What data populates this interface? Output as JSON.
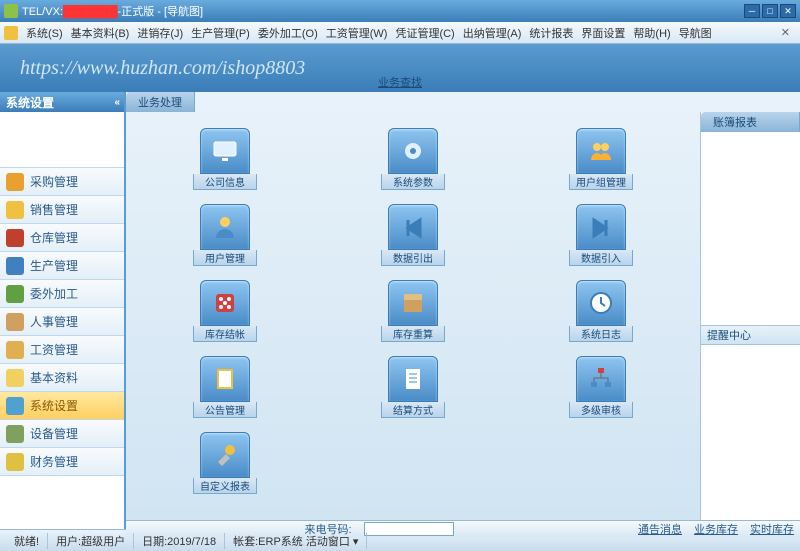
{
  "title": {
    "prefix": "TEL/VX:",
    "redacted": "███████",
    "suffix": "-正式版 - [导航图]"
  },
  "menu": [
    "系统(S)",
    "基本资料(B)",
    "进销存(J)",
    "生产管理(P)",
    "委外加工(O)",
    "工资管理(W)",
    "凭证管理(C)",
    "出纳管理(A)",
    "统计报表",
    "界面设置",
    "帮助(H)",
    "导航图"
  ],
  "banner_url": "https://www.huzhan.com/ishop8803",
  "banner_link": "业务查找",
  "sidebar": {
    "header": "系统设置",
    "items": [
      {
        "label": "采购管理",
        "color": "#e8a030"
      },
      {
        "label": "销售管理",
        "color": "#f0c040"
      },
      {
        "label": "仓库管理",
        "color": "#c04030"
      },
      {
        "label": "生产管理",
        "color": "#4080c0"
      },
      {
        "label": "委外加工",
        "color": "#60a040"
      },
      {
        "label": "人事管理",
        "color": "#d0a060"
      },
      {
        "label": "工资管理",
        "color": "#e0b050"
      },
      {
        "label": "基本资料",
        "color": "#f0d060"
      },
      {
        "label": "系统设置",
        "color": "#50a0d0",
        "active": true
      },
      {
        "label": "设备管理",
        "color": "#80a060"
      },
      {
        "label": "财务管理",
        "color": "#e0c040"
      }
    ]
  },
  "section": {
    "left": "业务处理",
    "right": "账簿报表"
  },
  "tiles": [
    {
      "label": "公司信息",
      "icon": "monitor"
    },
    {
      "label": "系统参数",
      "icon": "gear"
    },
    {
      "label": "用户组管理",
      "icon": "users"
    },
    {
      "label": "用户管理",
      "icon": "user"
    },
    {
      "label": "数据引出",
      "icon": "arrow-out"
    },
    {
      "label": "数据引入",
      "icon": "arrow-in"
    },
    {
      "label": "库存结帐",
      "icon": "dice"
    },
    {
      "label": "库存重算",
      "icon": "box"
    },
    {
      "label": "系统日志",
      "icon": "clock"
    },
    {
      "label": "公告管理",
      "icon": "note"
    },
    {
      "label": "结算方式",
      "icon": "doc"
    },
    {
      "label": "多级审核",
      "icon": "tree"
    },
    {
      "label": "自定义报表",
      "icon": "wrench"
    }
  ],
  "right_panel": {
    "reminder": "提醒中心"
  },
  "bottom": {
    "phone_label": "来电号码:",
    "notify": "通告消息",
    "stock": "业务库存",
    "realtime": "实时库存"
  },
  "status": {
    "ready": "就绪!",
    "user": "用户:超级用户",
    "date": "日期:2019/7/18",
    "account": "帐套:ERP系统 活动窗口 ▾"
  }
}
